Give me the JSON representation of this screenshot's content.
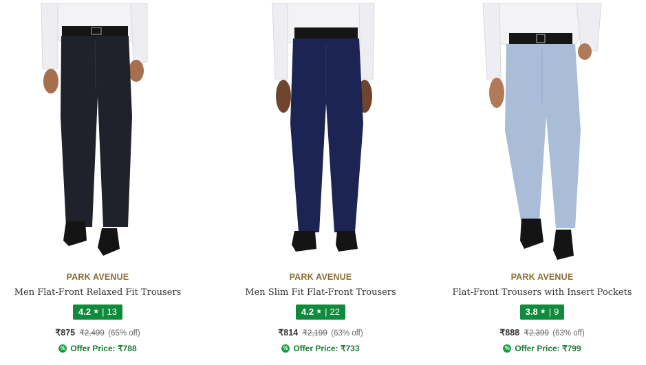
{
  "products": [
    {
      "brand": "PARK AVENUE",
      "name": "Men Flat-Front Relaxed Fit Trousers",
      "rating": "4.2",
      "rating_count": "13",
      "price": "₹875",
      "mrp": "₹2,499",
      "discount": "(65% off)",
      "offer": "Offer Price: ₹788",
      "trouser_color": "#20222b",
      "photo_desc": "dark-charcoal-trousers"
    },
    {
      "brand": "PARK AVENUE",
      "name": "Men Slim Fit Flat-Front Trousers",
      "rating": "4.2",
      "rating_count": "22",
      "price": "₹814",
      "mrp": "₹2,199",
      "discount": "(63% off)",
      "offer": "Offer Price: ₹733",
      "trouser_color": "#1b2452",
      "photo_desc": "navy-trousers"
    },
    {
      "brand": "PARK AVENUE",
      "name": "Flat-Front Trousers with Insert Pockets",
      "rating": "3.8",
      "rating_count": "9",
      "price": "₹888",
      "mrp": "₹2,399",
      "discount": "(63% off)",
      "offer": "Offer Price: ₹799",
      "trouser_color": "#a9bcd8",
      "photo_desc": "light-blue-trousers"
    }
  ],
  "colors": {
    "brand_text": "#8a6d2f",
    "rating_bg": "#108a3c",
    "offer_text": "#1a7a33",
    "shirt": "#f4f4f6",
    "skin": "#8a5a3c",
    "belt": "#1a1a1a",
    "shoe": "#141414"
  },
  "icons": {
    "star": "star-icon",
    "offer": "offer-percent-icon"
  }
}
